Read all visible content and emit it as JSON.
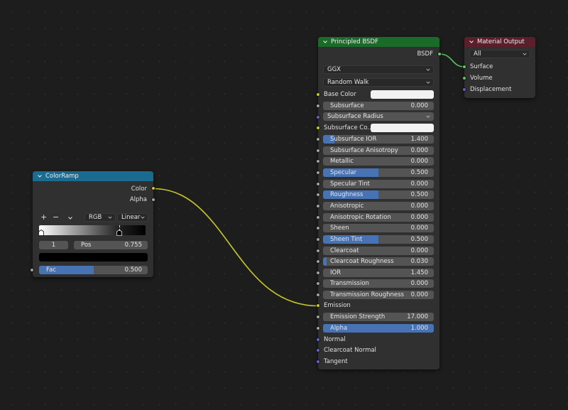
{
  "colors": {
    "bsdf_header": "#1a6b2a",
    "output_header": "#5c1e2a",
    "ramp_header": "#1a6b8f",
    "slider_fill": "#4772b3",
    "link_yellow": "#c7c729",
    "link_green": "#5bc75b"
  },
  "color_ramp": {
    "title": "ColorRamp",
    "outputs": [
      "Color",
      "Alpha"
    ],
    "add_label": "+",
    "remove_label": "−",
    "menu_label": "⌄",
    "mode": "RGB",
    "interpolation": "Linear",
    "stop_index": "1",
    "pos_label": "Pos",
    "pos_value": "0.755",
    "fac_label": "Fac",
    "fac_value": "0.500",
    "fac_fraction": 0.5
  },
  "principled": {
    "title": "Principled BSDF",
    "output": "BSDF",
    "distribution": "GGX",
    "subsurface_method": "Random Walk",
    "base_color_label": "Base Color",
    "subsurface_radius_label": "Subsurface Radius",
    "subsurface_color_label": "Subsurface Co...",
    "inputs": [
      {
        "label": "Subsurface",
        "value": "0.000",
        "fill": 0
      },
      {
        "label": "Subsurface IOR",
        "value": "1.400",
        "fill": 0.1
      },
      {
        "label": "Subsurface Anisotropy",
        "value": "0.000",
        "fill": 0
      },
      {
        "label": "Metallic",
        "value": "0.000",
        "fill": 0
      },
      {
        "label": "Specular",
        "value": "0.500",
        "fill": 0.5
      },
      {
        "label": "Specular Tint",
        "value": "0.000",
        "fill": 0
      },
      {
        "label": "Roughness",
        "value": "0.500",
        "fill": 0.5
      },
      {
        "label": "Anisotropic",
        "value": "0.000",
        "fill": 0
      },
      {
        "label": "Anisotropic Rotation",
        "value": "0.000",
        "fill": 0
      },
      {
        "label": "Sheen",
        "value": "0.000",
        "fill": 0
      },
      {
        "label": "Sheen Tint",
        "value": "0.500",
        "fill": 0.5
      },
      {
        "label": "Clearcoat",
        "value": "0.000",
        "fill": 0
      },
      {
        "label": "Clearcoat Roughness",
        "value": "0.030",
        "fill": 0.03
      },
      {
        "label": "IOR",
        "value": "1.450",
        "fill": 0
      },
      {
        "label": "Transmission",
        "value": "0.000",
        "fill": 0
      },
      {
        "label": "Transmission Roughness",
        "value": "0.000",
        "fill": 0
      }
    ],
    "emission_label": "Emission",
    "emission_strength": {
      "label": "Emission Strength",
      "value": "17.000",
      "fill": 0
    },
    "alpha": {
      "label": "Alpha",
      "value": "1.000",
      "fill": 1
    },
    "normal_label": "Normal",
    "clearcoat_normal_label": "Clearcoat Normal",
    "tangent_label": "Tangent"
  },
  "material_output": {
    "title": "Material Output",
    "target": "All",
    "inputs": [
      "Surface",
      "Volume",
      "Displacement"
    ]
  }
}
